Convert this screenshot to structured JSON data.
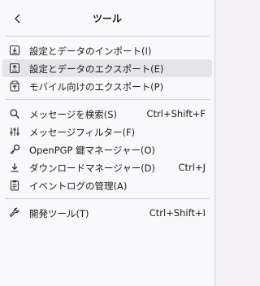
{
  "header": {
    "title": "ツール"
  },
  "groups": [
    [
      {
        "label": "設定とデータのインポート(I)",
        "shortcut": "",
        "icon": "import-icon"
      },
      {
        "label": "設定とデータのエクスポート(E)",
        "shortcut": "",
        "icon": "export-icon"
      },
      {
        "label": "モバイル向けのエクスポート(P)",
        "shortcut": "",
        "icon": "mobile-export-icon"
      }
    ],
    [
      {
        "label": "メッセージを検索(S)",
        "shortcut": "Ctrl+Shift+F",
        "icon": "search-icon"
      },
      {
        "label": "メッセージフィルター(F)",
        "shortcut": "",
        "icon": "filter-icon"
      },
      {
        "label": "OpenPGP 鍵マネージャー(O)",
        "shortcut": "",
        "icon": "key-icon"
      },
      {
        "label": "ダウンロードマネージャー(D)",
        "shortcut": "Ctrl+J",
        "icon": "download-icon"
      },
      {
        "label": "イベントログの管理(A)",
        "shortcut": "",
        "icon": "log-icon"
      }
    ],
    [
      {
        "label": "開発ツール(T)",
        "shortcut": "Ctrl+Shift+I",
        "icon": "wrench-icon"
      }
    ]
  ]
}
